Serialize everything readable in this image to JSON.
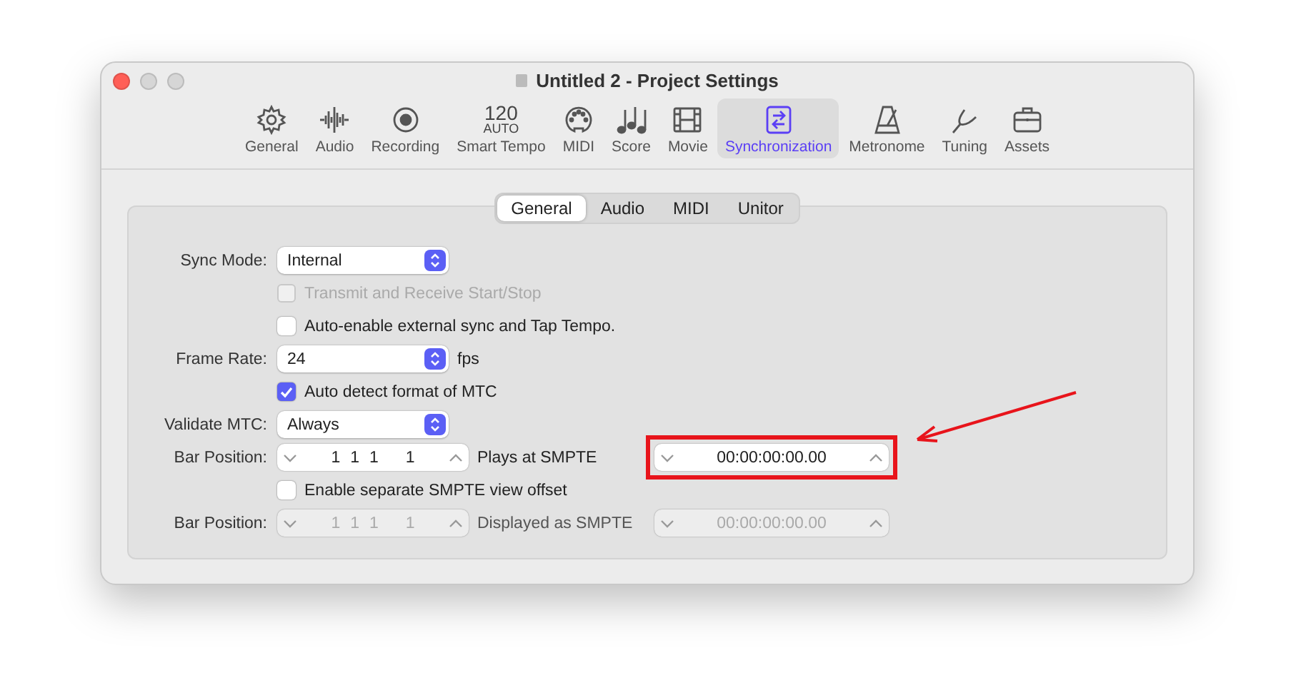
{
  "window": {
    "title": "Untitled 2 - Project Settings"
  },
  "toolbar": [
    {
      "label": "General",
      "kind": "gear",
      "selected": false
    },
    {
      "label": "Audio",
      "kind": "waveform",
      "selected": false
    },
    {
      "label": "Recording",
      "kind": "record",
      "selected": false
    },
    {
      "label": "Smart Tempo",
      "kind": "tempo",
      "icon_text": [
        "120",
        "AUTO"
      ],
      "selected": false
    },
    {
      "label": "MIDI",
      "kind": "midi",
      "selected": false
    },
    {
      "label": "Score",
      "kind": "notes",
      "selected": false
    },
    {
      "label": "Movie",
      "kind": "film",
      "selected": false
    },
    {
      "label": "Synchronization",
      "kind": "sync",
      "selected": true
    },
    {
      "label": "Metronome",
      "kind": "metronome",
      "selected": false
    },
    {
      "label": "Tuning",
      "kind": "fork",
      "selected": false
    },
    {
      "label": "Assets",
      "kind": "briefcase",
      "selected": false
    }
  ],
  "tabs": [
    {
      "label": "General",
      "selected": true
    },
    {
      "label": "Audio",
      "selected": false
    },
    {
      "label": "MIDI",
      "selected": false
    },
    {
      "label": "Unitor",
      "selected": false
    }
  ],
  "rows": [
    {
      "kind": "popup",
      "label": "Sync Mode:",
      "value": "Internal"
    },
    {
      "kind": "checkbox",
      "text": "Transmit and Receive Start/Stop",
      "checked": false,
      "disabled": true
    },
    {
      "kind": "checkbox",
      "text": "Auto-enable external sync and Tap Tempo.",
      "checked": false,
      "disabled": false
    },
    {
      "kind": "popup",
      "label": "Frame Rate:",
      "value": "24",
      "unit": "fps"
    },
    {
      "kind": "checkbox",
      "text": "Auto detect format of MTC",
      "checked": true,
      "disabled": false
    },
    {
      "kind": "popup",
      "label": "Validate MTC:",
      "value": "Always"
    },
    {
      "kind": "position",
      "label": "Bar Position:",
      "parts": [
        "1",
        "1",
        "1",
        "1"
      ],
      "middle": "Plays at SMPTE",
      "smpte": "00:00:00:00.00",
      "disabled": false,
      "highlighted": true
    },
    {
      "kind": "checkbox",
      "text": "Enable separate SMPTE view offset",
      "checked": false,
      "disabled": false
    },
    {
      "kind": "position",
      "label": "Bar Position:",
      "parts": [
        "1",
        "1",
        "1",
        "1"
      ],
      "middle": "Displayed as SMPTE",
      "smpte": "00:00:00:00.00",
      "disabled": true,
      "highlighted": false
    }
  ]
}
